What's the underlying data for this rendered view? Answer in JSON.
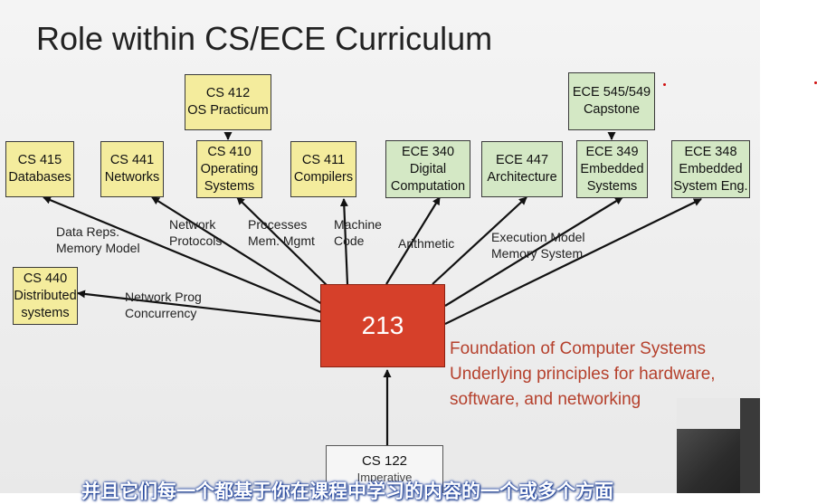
{
  "title": "Role within CS/ECE Curriculum",
  "colors": {
    "elective": "#f4ec9d",
    "ece_course": "#d4e8c5",
    "core": "#d6402a",
    "foundation_text": "#b5402c"
  },
  "courses": {
    "cs415": [
      "CS 415",
      "Databases"
    ],
    "cs441": [
      "CS 441",
      "Networks"
    ],
    "cs410": [
      "CS 410",
      "Operating",
      "Systems"
    ],
    "cs412": [
      "CS 412",
      "OS Practicum"
    ],
    "cs411": [
      "CS 411",
      "Compilers"
    ],
    "ece340": [
      "ECE 340",
      "Digital",
      "Computation"
    ],
    "ece447": [
      "ECE 447",
      "Architecture"
    ],
    "ece349": [
      "ECE 349",
      "Embedded",
      "Systems"
    ],
    "ece545": [
      "ECE 545/549",
      "Capstone"
    ],
    "ece348": [
      "ECE 348",
      "Embedded",
      "System Eng."
    ],
    "cs440": [
      "CS 440",
      "Distributed",
      "systems"
    ]
  },
  "edge_labels": {
    "data_reps": [
      "Data Reps.",
      "Memory Model"
    ],
    "network_protocols": [
      "Network",
      "Protocols"
    ],
    "processes": [
      "Processes",
      "Mem. Mgmt"
    ],
    "machine_code": [
      "Machine",
      "Code"
    ],
    "arithmetic": [
      "Arithmetic"
    ],
    "execution_model": [
      "Execution Model",
      "Memory System"
    ],
    "network_prog": [
      "Network Prog",
      "Concurrency"
    ]
  },
  "core": {
    "label": "213"
  },
  "foundation": [
    "Foundation of Computer Systems",
    "Underlying principles for hardware,",
    "software, and networking"
  ],
  "prereq": {
    "code": "CS 122",
    "name": "Imperative"
  },
  "subtitle": "并且它们每一个都基于你在课程中学习的内容的一个或多个方面"
}
